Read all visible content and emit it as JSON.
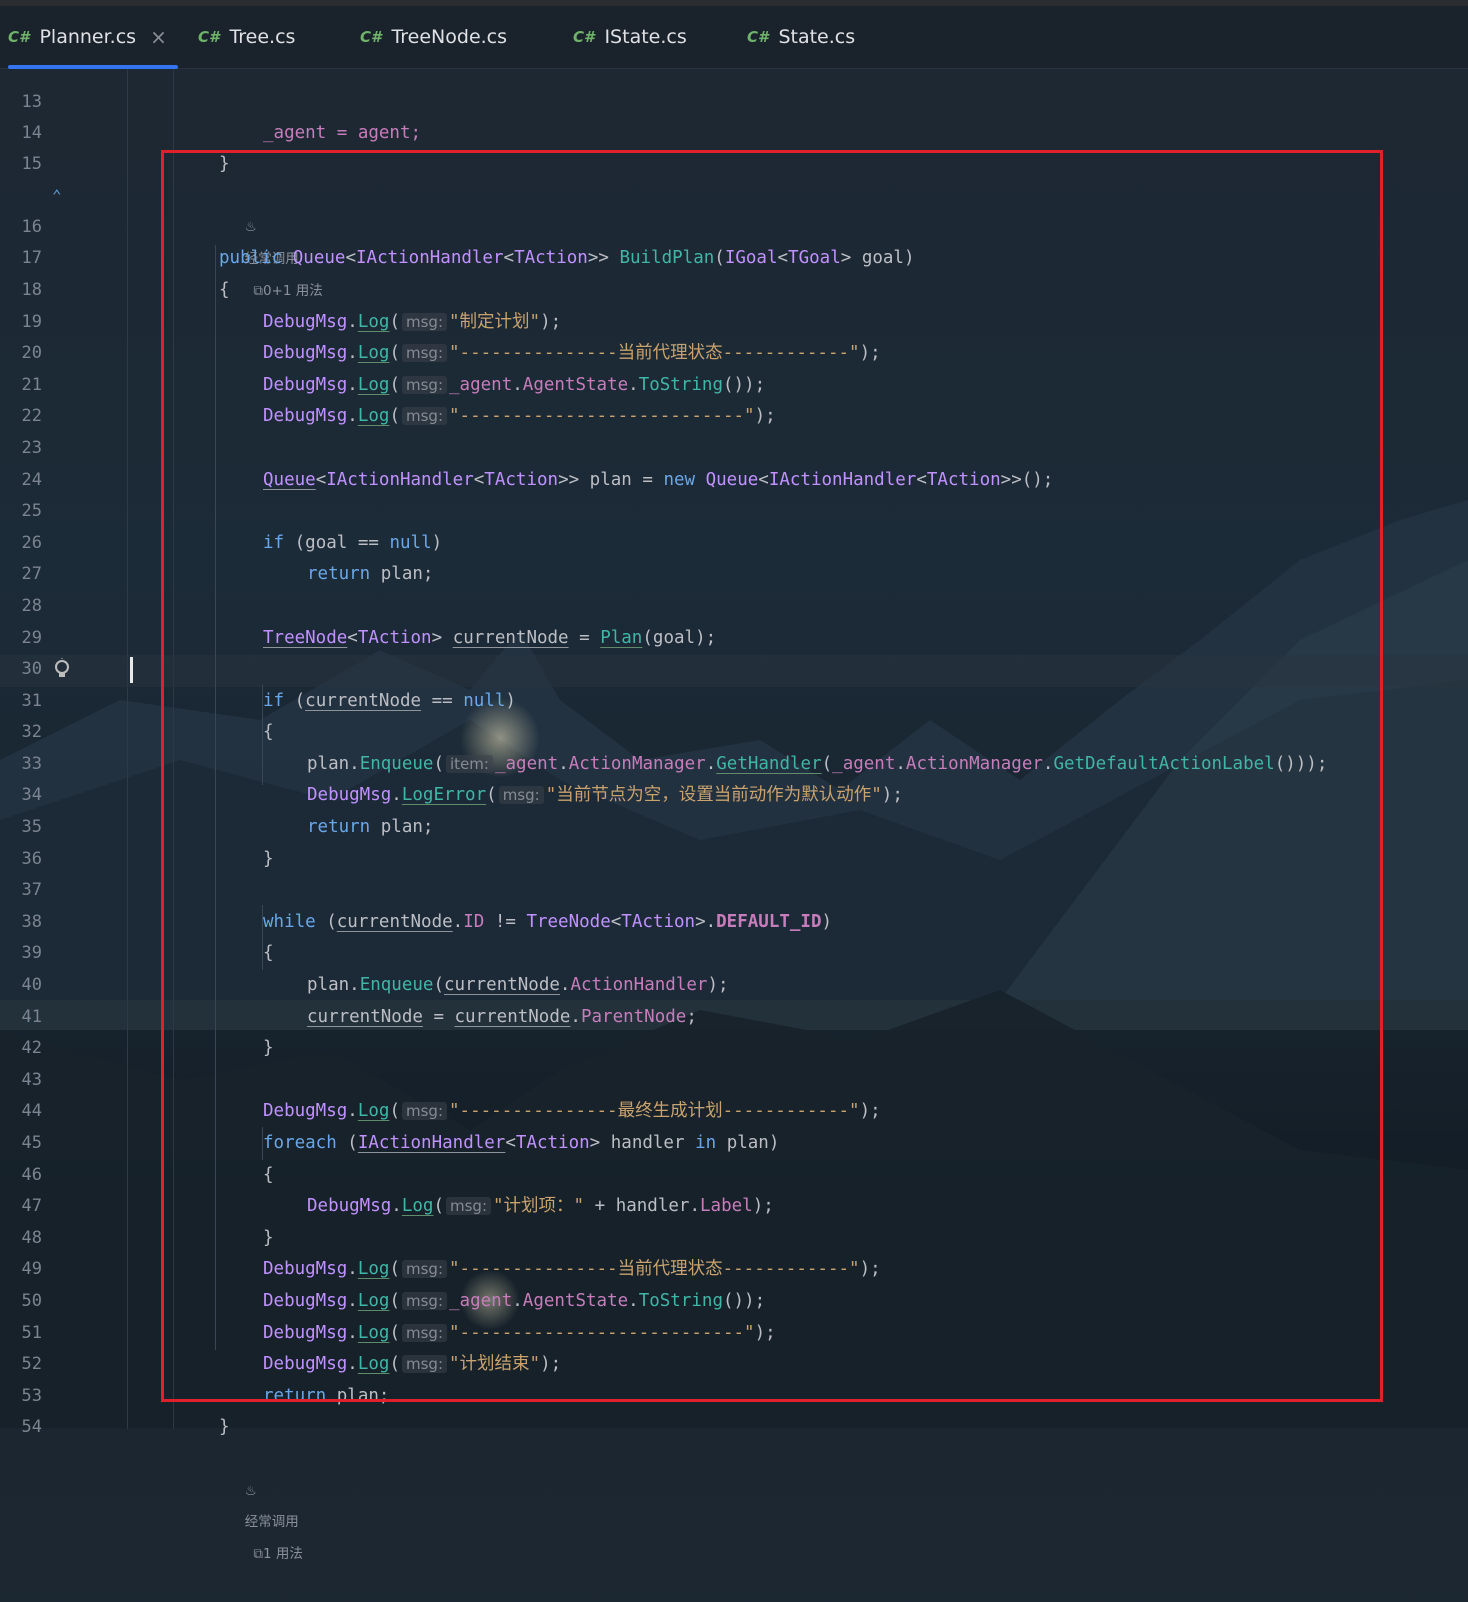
{
  "tabs": [
    {
      "icon": "C#",
      "label": "Planner.cs",
      "active": true,
      "close": "×"
    },
    {
      "icon": "C#",
      "label": "Tree.cs"
    },
    {
      "icon": "C#",
      "label": "TreeNode.cs"
    },
    {
      "icon": "C#",
      "label": "IState.cs"
    },
    {
      "icon": "C#",
      "label": "State.cs"
    }
  ],
  "hints": {
    "frequent_calls": "经常调用",
    "usages_0_1": "0+1 用法",
    "usages_1": "1 用法"
  },
  "line_numbers": [
    "13",
    "14",
    "15",
    "16",
    "17",
    "18",
    "19",
    "20",
    "21",
    "22",
    "23",
    "24",
    "25",
    "26",
    "27",
    "28",
    "29",
    "30",
    "31",
    "32",
    "33",
    "34",
    "35",
    "36",
    "37",
    "38",
    "39",
    "40",
    "41",
    "42",
    "43",
    "44",
    "45",
    "46",
    "47",
    "48",
    "49",
    "50",
    "51",
    "52",
    "53",
    "54"
  ],
  "code": {
    "l13": "_agent = agent;",
    "l14": "}",
    "l16_public": "public",
    "l16_queue": "Queue",
    "l16_iah": "IActionHandler",
    "l16_taction": "TAction",
    "l16_method": "BuildPlan",
    "l16_igoal": "IGoal",
    "l16_tgoal": "TGoal",
    "l16_param": "goal",
    "brace_open": "{",
    "brace_close": "}",
    "debugmsg": "DebugMsg",
    "log": "Log",
    "logerror": "LogError",
    "msg_hint": "msg:",
    "item_hint": "item:",
    "s18": "\"制定计划\"",
    "s19": "\"---------------当前代理状态------------\"",
    "agent": "_agent",
    "agentstate": "AgentState",
    "tostring": "ToString",
    "s21": "\"---------------------------\"",
    "plan": "plan",
    "new": "new",
    "if": "if",
    "null": "null",
    "return": "return",
    "treenode": "TreeNode",
    "currentnode": "currentNode",
    "plan_method": "Plan",
    "enqueue": "Enqueue",
    "actionmanager": "ActionManager",
    "gethandler": "GetHandler",
    "getdefault": "GetDefaultActionLabel",
    "s33": "\"当前节点为空，设置当前动作为默认动作\"",
    "while": "while",
    "id": "ID",
    "default_id": "DEFAULT_ID",
    "actionhandler": "ActionHandler",
    "parentnode": "ParentNode",
    "s43": "\"---------------最终生成计划------------\"",
    "foreach": "foreach",
    "handler": "handler",
    "in": "in",
    "s46": "\"计划项：\"",
    "label": "Label",
    "s48": "\"---------------当前代理状态------------\"",
    "s51": "\"计划结束\""
  },
  "colors": {
    "highlight_box": "#e0202a",
    "active_tab_underline": "#3574f0"
  }
}
